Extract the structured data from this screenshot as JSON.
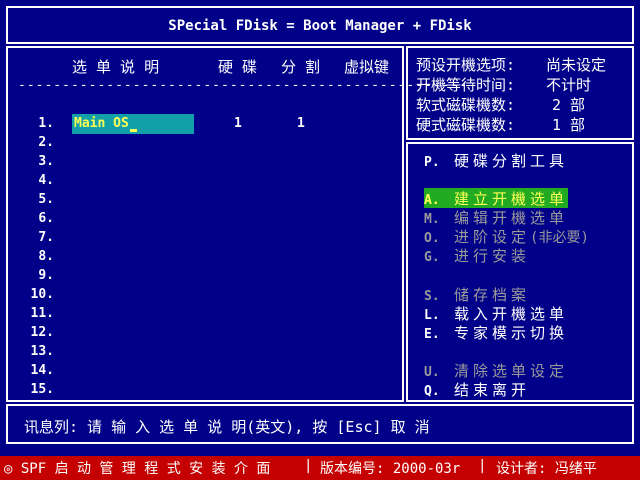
{
  "title": "SPecial FDisk = Boot Manager + FDisk",
  "table": {
    "headers": [
      "选 单 说 明",
      "硬 碟",
      "分 割",
      "虚拟键"
    ],
    "dashes": "---------------------------------------------------",
    "rows": [
      "1.",
      "2.",
      "3.",
      "4.",
      "5.",
      "6.",
      "7.",
      "8.",
      "9.",
      "10.",
      "11.",
      "12.",
      "13.",
      "14.",
      "15."
    ],
    "entry": {
      "name": "Main OS",
      "disk": "1",
      "partition": "1"
    }
  },
  "info": [
    {
      "label": "预设开機选项:",
      "value": "尚未设定"
    },
    {
      "label": "开機等待时间:",
      "value": "不计时"
    },
    {
      "label": "软式磁碟機数:",
      "value": "2 部"
    },
    {
      "label": "硬式磁碟機数:",
      "value": "1 部"
    }
  ],
  "menu": [
    {
      "key": "P.",
      "label": "硬碟分割工具",
      "suffix": ""
    },
    {
      "key": "A.",
      "label": "建立开機选单",
      "suffix": ""
    },
    {
      "key": "M.",
      "label": "编辑开機选单",
      "suffix": ""
    },
    {
      "key": "O.",
      "label": "进阶设定",
      "suffix": "(非必要)"
    },
    {
      "key": "G.",
      "label": "进行安装",
      "suffix": ""
    },
    {
      "key": "S.",
      "label": "储存档案",
      "suffix": ""
    },
    {
      "key": "L.",
      "label": "载入开機选单",
      "suffix": ""
    },
    {
      "key": "E.",
      "label": "专家模示切换",
      "suffix": ""
    },
    {
      "key": "U.",
      "label": "清除选单设定",
      "suffix": ""
    },
    {
      "key": "Q.",
      "label": "结束离开",
      "suffix": ""
    }
  ],
  "message": "讯息列: 请 输 入 选 单 说 明(英文), 按 [Esc] 取 消",
  "status": {
    "left": "◎ SPF 启 动 管 理 程 式 安 装 介 面",
    "sep1": "|",
    "version": "版本编号: 2000-03r",
    "sep2": "|",
    "designer": "设计者: 冯绪平"
  },
  "colors": {
    "background": "#000088",
    "status_bar": "#c40000",
    "selected": "#22aa22",
    "entry_field": "#12a0a8",
    "highlight_text": "#ffff55"
  }
}
